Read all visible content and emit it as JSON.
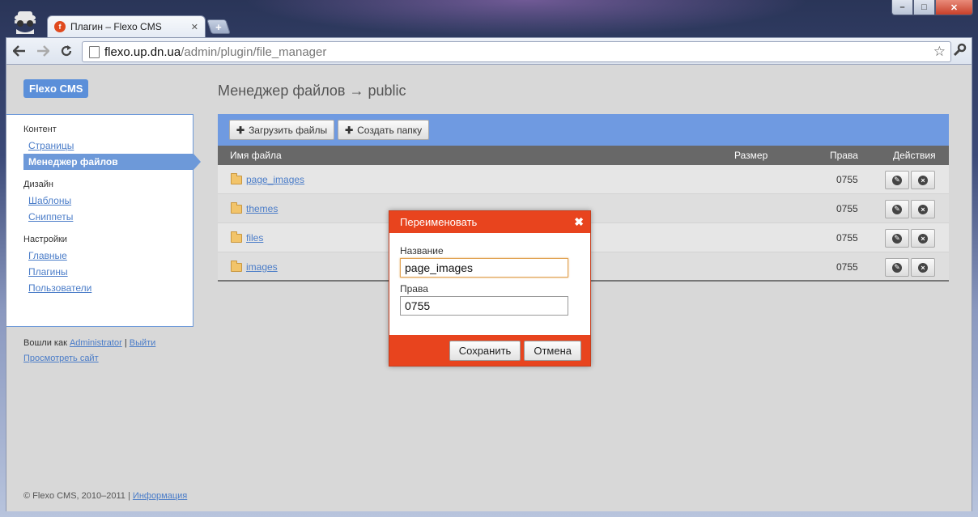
{
  "browser": {
    "tab_title": "Плагин – Flexo CMS",
    "tab_favicon": "f",
    "tab_close": "✕",
    "new_tab": "+",
    "url_host": "flexo.up.dn.ua",
    "url_path": "/admin/plugin/file_manager",
    "window_buttons": [
      "–",
      "□",
      "✕"
    ]
  },
  "sidebar": {
    "logo": "Flexo CMS",
    "groups": [
      {
        "heading": "Контент",
        "items": [
          {
            "label": "Страницы"
          },
          {
            "label": "Менеджер файлов"
          }
        ]
      },
      {
        "heading": "Дизайн",
        "items": [
          {
            "label": "Шаблоны"
          },
          {
            "label": "Сниппеты"
          }
        ]
      },
      {
        "heading": "Настройки",
        "items": [
          {
            "label": "Главные"
          },
          {
            "label": "Плагины"
          },
          {
            "label": "Пользователи"
          }
        ]
      }
    ],
    "logged_in_prefix": "Вошли как",
    "user": "Administrator",
    "separator": "|",
    "logout": "Выйти",
    "view_site": "Просмотреть сайт"
  },
  "footer": {
    "copyright": "© Flexo CMS, 2010–2011",
    "separator": "|",
    "info_link": "Информация"
  },
  "main": {
    "title": "Менеджер файлов → public",
    "upload_button": "Загрузить файлы",
    "create_folder_button": "Создать папку",
    "columns": {
      "name": "Имя файла",
      "size": "Размер",
      "rights": "Права",
      "actions": "Действия"
    },
    "rows": [
      {
        "name": "page_images",
        "rights": "0755"
      },
      {
        "name": "themes",
        "rights": "0755"
      },
      {
        "name": "files",
        "rights": "0755"
      },
      {
        "name": "images",
        "rights": "0755"
      }
    ]
  },
  "modal": {
    "title": "Переименовать",
    "close_glyph": "✖",
    "name_label": "Название",
    "name_value": "page_images",
    "rights_label": "Права",
    "rights_value": "0755",
    "save_button": "Сохранить",
    "cancel_button": "Отмена"
  },
  "colors": {
    "accent_blue": "#6f9ae1",
    "modal_orange": "#e8441e",
    "link": "#4a7cc8"
  }
}
